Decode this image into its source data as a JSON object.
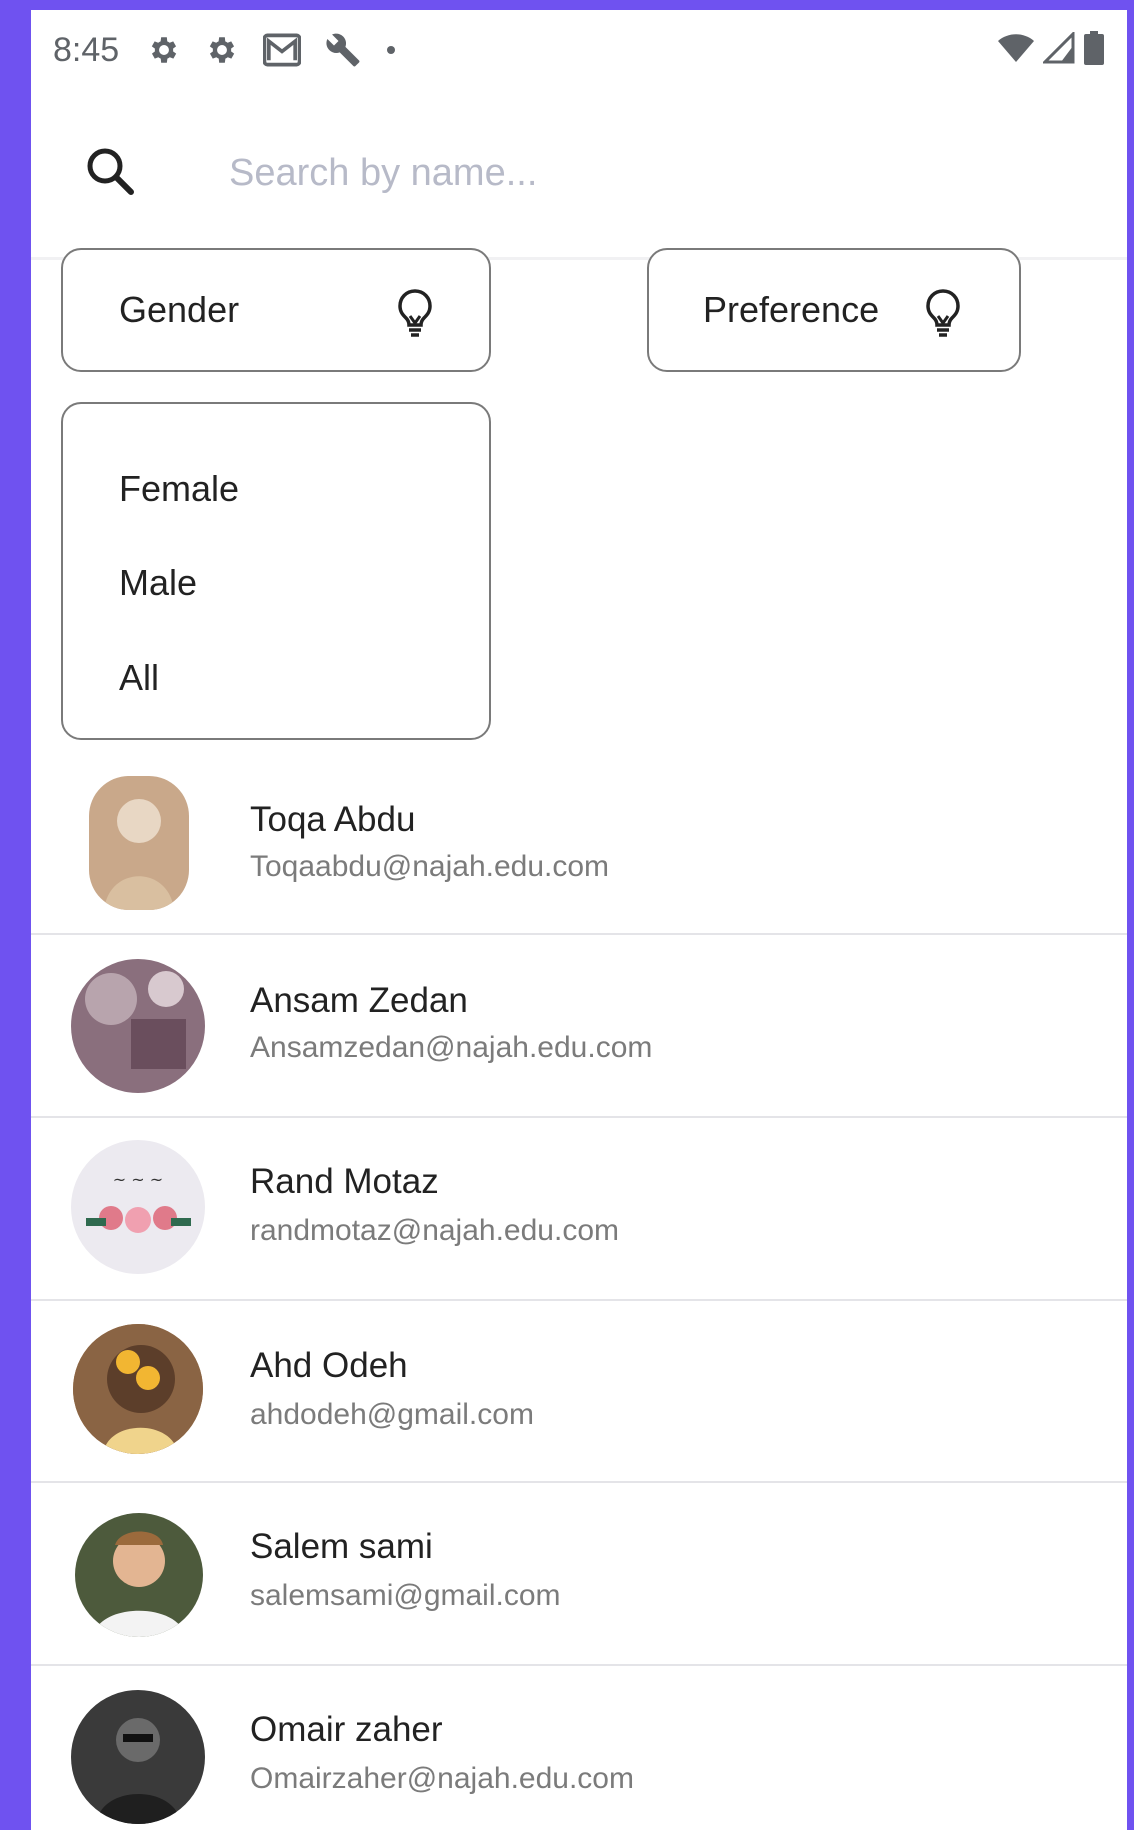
{
  "status_bar": {
    "time": "8:45",
    "left_icons": [
      "settings-icon",
      "settings-icon",
      "gmail-icon",
      "wrench-icon",
      "dot-icon"
    ],
    "right_icons": [
      "wifi-icon",
      "signal-icon",
      "battery-icon"
    ]
  },
  "search": {
    "placeholder": "Search by name...",
    "value": ""
  },
  "filters": {
    "gender_label": "Gender",
    "preference_label": "Preference",
    "icon": "lightbulb-icon"
  },
  "gender_dropdown": {
    "options": [
      "Female",
      "Male",
      "All"
    ]
  },
  "users": [
    {
      "name": "Toqa Abdu",
      "email": "Toqaabdu@najah.edu.com",
      "avatar_color": "#c9a88a"
    },
    {
      "name": "Ansam Zedan",
      "email": "Ansamzedan@najah.edu.com",
      "avatar_color": "#8a6f7d"
    },
    {
      "name": "Rand Motaz",
      "email": "randmotaz@najah.edu.com",
      "avatar_color": "#eceaf0"
    },
    {
      "name": "Ahd Odeh",
      "email": "ahdodeh@gmail.com",
      "avatar_color": "#b88a5a"
    },
    {
      "name": "Salem sami",
      "email": "salemsami@gmail.com",
      "avatar_color": "#4d5a3c"
    },
    {
      "name": "Omair zaher",
      "email": "Omairzaher@najah.edu.com",
      "avatar_color": "#3a3a3a"
    }
  ],
  "colors": {
    "frame": "#6f52f0",
    "border": "#7a7a7a",
    "placeholder": "#b7bac8"
  }
}
